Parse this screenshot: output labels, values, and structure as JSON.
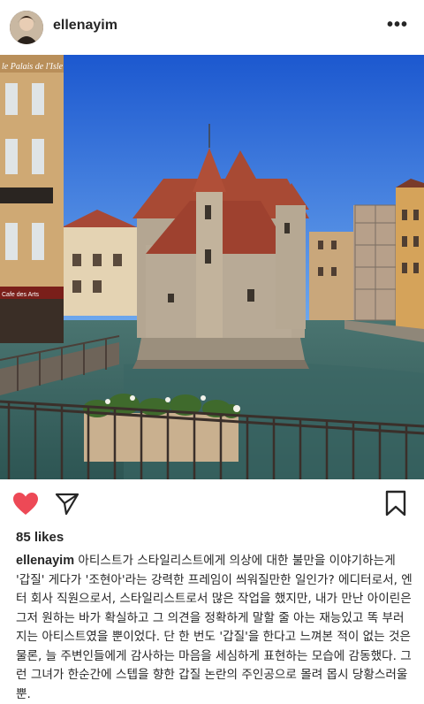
{
  "post": {
    "username": "ellenayim",
    "more_icon": "more-dots-icon",
    "likes": "85 likes",
    "caption_user": "ellenayim",
    "caption_text": "아티스트가 스타일리스트에게 의상에 대한 불만을 이야기하는게 '갑질' 게다가 '조현아'라는 강력한 프레임이 씌워질만한 일인가? 에디터로서, 엔터 회사 직원으로서, 스타일리스트로서 많은 작업을 했지만, 내가 만난 아이린은 그저 원하는 바가 확실하고 그 의견을 정확하게 말할 줄 아는 재능있고 똑 부러지는 아티스트였을 뿐이었다. 단 한 번도 '갑질'을 한다고 느껴본 적이 없는 것은 물론, 늘 주변인들에게 감사하는 마음을 세심하게 표현하는 모습에 감동했다. 그런 그녀가 한순간에 스텝을 향한 갑질 논란의 주인공으로 몰려 몹시 당황스러울 뿐."
  },
  "photo": {
    "shop_sign": "le Palais de l'Isle",
    "cafe_sign": "Cafe des Arts"
  },
  "colors": {
    "like": "#ed4956",
    "sky_top": "#1e5fd6",
    "sky_bottom": "#6ea9ee",
    "water": "#3d6b6a",
    "roof": "#b0503a",
    "stone": "#b7a997"
  },
  "icons": [
    "heart-icon",
    "send-icon",
    "bookmark-icon"
  ]
}
